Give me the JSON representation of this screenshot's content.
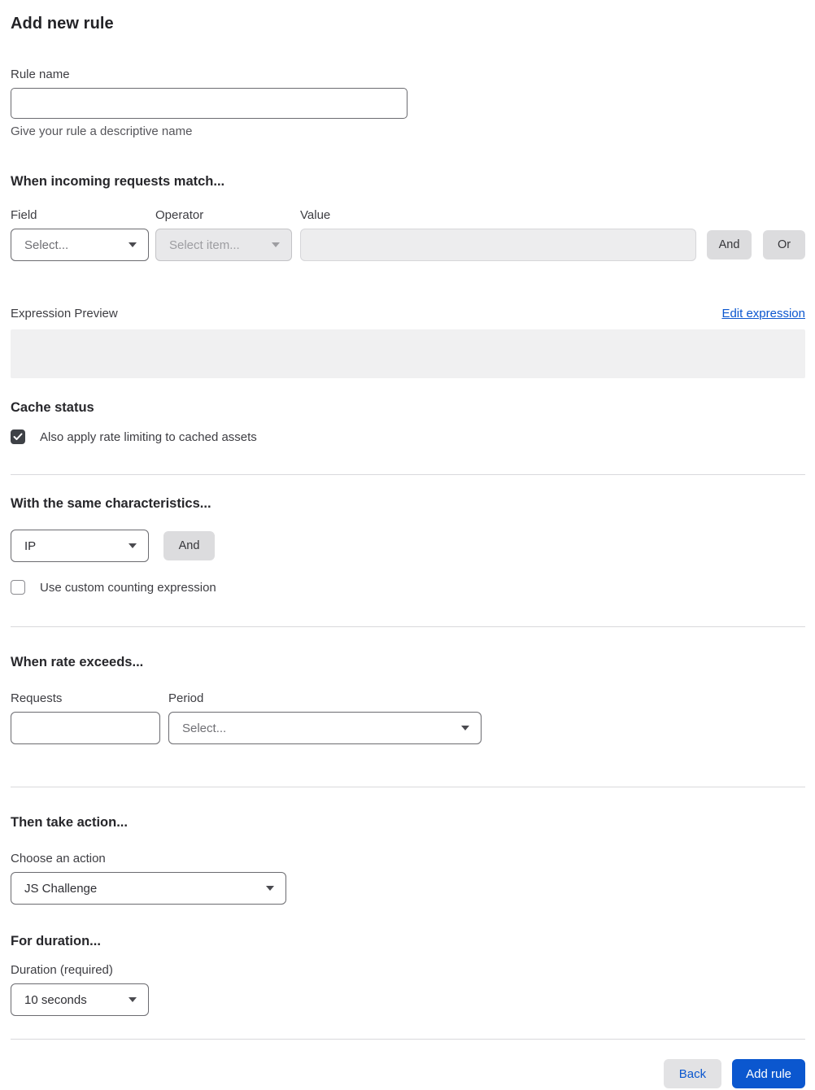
{
  "page": {
    "title": "Add new rule"
  },
  "rule_name": {
    "label": "Rule name",
    "value": "",
    "helper": "Give your rule a descriptive name"
  },
  "match": {
    "heading": "When incoming requests match...",
    "field": {
      "label": "Field",
      "selected": "Select..."
    },
    "operator": {
      "label": "Operator",
      "selected": "Select item...",
      "disabled": true
    },
    "value": {
      "label": "Value",
      "value": "",
      "disabled": true
    },
    "and_label": "And",
    "or_label": "Or"
  },
  "expression": {
    "label": "Expression Preview",
    "edit_link": "Edit expression",
    "value": ""
  },
  "cache": {
    "heading": "Cache status",
    "checkbox_label": "Also apply rate limiting to cached assets",
    "checked": true
  },
  "characteristics": {
    "heading": "With the same characteristics...",
    "selected": "IP",
    "and_label": "And",
    "checkbox_label": "Use custom counting expression",
    "checked": false
  },
  "rate": {
    "heading": "When rate exceeds...",
    "requests": {
      "label": "Requests",
      "value": ""
    },
    "period": {
      "label": "Period",
      "selected": "Select..."
    }
  },
  "action": {
    "heading": "Then take action...",
    "label": "Choose an action",
    "selected": "JS Challenge"
  },
  "duration": {
    "heading": "For duration...",
    "label": "Duration (required)",
    "selected": "10 seconds"
  },
  "footer": {
    "back_label": "Back",
    "add_label": "Add rule"
  },
  "colors": {
    "accent_blue": "#0b57cf",
    "checkbox_checked": "#3e4146",
    "secondary_button_gray": "#dcdcde",
    "disabled_bg": "#e8e8ea",
    "expression_box_bg": "#f0f0f1"
  }
}
